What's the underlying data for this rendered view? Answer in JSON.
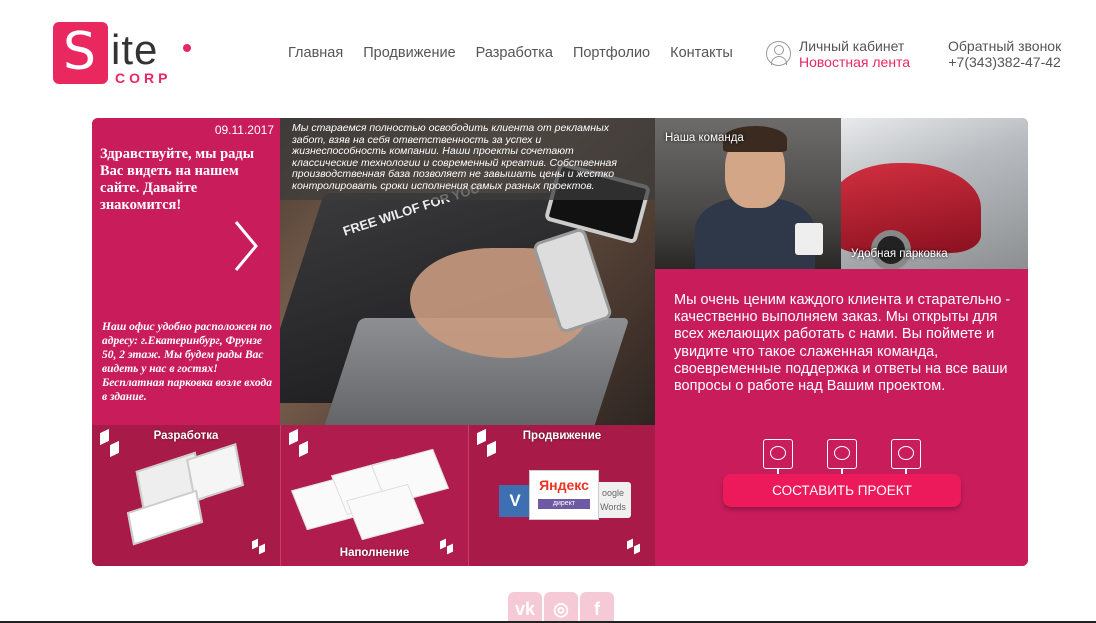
{
  "header": {
    "logo": {
      "s": "S",
      "ite": "ite",
      "corp": "CORP"
    },
    "nav": [
      "Главная",
      "Продвижение",
      "Разработка",
      "Портфолио",
      "Контакты"
    ],
    "account": {
      "label": "Личный кабинет",
      "news": "Новостная лента",
      "icon": "user-icon"
    },
    "callback": {
      "label": "Обратный звонок",
      "phone": "+7(343)382-47-42"
    }
  },
  "welcome": {
    "date": "09.11.2017",
    "greeting": "Здравствуйте, мы рады Вас видеть на нашем сайте. Давайте знакомится!",
    "office": "Наш офис удобно расположен по адресу: г.Екатеринбург, Фрунзе 50, 2 этаж. Мы будем рады Вас видеть у нас в гостях! Бесплатная парковка возле входа в здание."
  },
  "photo": {
    "overlay": "Мы стараемся полностью освободить клиента от рекламных забот, взяв на себя ответственность за успех и жизнеспособность компании. Наши проекты сочетают классические технологии и современный креатив. Собственная производственная база позволяет не завышать цены и жестко контролировать сроки исполнения самых разных проектов.",
    "laptop_label": "FREE WILOF FOR YOU"
  },
  "team": {
    "label": "Наша команда"
  },
  "parking": {
    "label": "Удобная парковка"
  },
  "info": {
    "text": "Мы очень ценим каждого клиента и старательно - качественно выполняем заказ. Мы открыты для всех желающих работать с нами. Вы поймете и увидите что такое слаженная команда, своевременные поддержка и ответы на все ваши вопросы о работе над Вашим проектом.",
    "cta": "СОСТАВИТЬ ПРОЕКТ",
    "icons": [
      "presentation-icon",
      "chart-icon",
      "finance-icon"
    ]
  },
  "tiles": {
    "development": "Разработка",
    "content": "Наполнение",
    "promotion": "Продвижение",
    "yandex": "Яндекс",
    "yandex_sub": "директ",
    "google": "oogle Words",
    "vk": "V"
  },
  "social": [
    "vk-icon",
    "instagram-icon",
    "facebook-icon"
  ],
  "social_labels": {
    "vk": "vk",
    "instagram": "◎",
    "facebook": "f"
  },
  "colors": {
    "accent": "#e8285f",
    "panel": "#c91d5b",
    "tile": "#a81a48"
  }
}
